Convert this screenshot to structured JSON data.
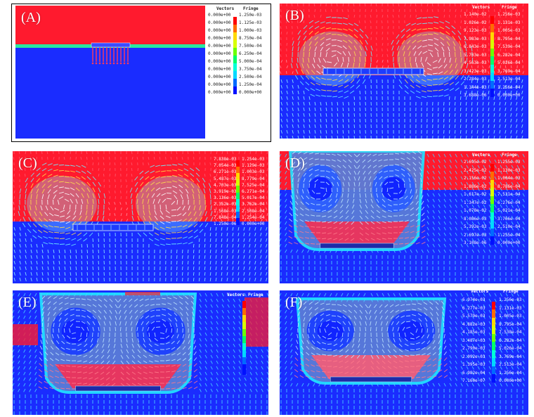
{
  "colors": {
    "red": "#ff1a2e",
    "blue": "#1a2cff",
    "cyan": "#22e0ff",
    "legend_scale": [
      "#ff0000",
      "#ff6a00",
      "#ffd800",
      "#d8ff00",
      "#6aff00",
      "#00ff6a",
      "#00ffd8",
      "#00d8ff",
      "#006aff",
      "#0010ff"
    ]
  },
  "panels": [
    {
      "label": "(A)",
      "legend": {
        "header_left": "Vectors",
        "header_right": "Fringe",
        "left": [
          "0.000e+00",
          "0.000e+00",
          "0.000e+00",
          "0.000e+00",
          "0.000e+00",
          "0.000e+00",
          "0.000e+00",
          "0.000e+00",
          "0.000e+00",
          "0.000e+00",
          "0.000e+00"
        ],
        "right": [
          "1.250e-03",
          "1.125e-03",
          "1.000e-03",
          "8.750e-04",
          "7.500e-04",
          "6.250e-04",
          "5.000e-04",
          "3.750e-04",
          "2.500e-04",
          "1.250e-04",
          "0.000e+00"
        ]
      }
    },
    {
      "label": "(B)",
      "legend": {
        "header_left": "Vectors",
        "header_right": "Fringe",
        "left": [
          "1.140e-02",
          "1.026e-02",
          "9.123e-03",
          "7.983e-03",
          "6.843e-03",
          "5.703e-03",
          "4.563e-03",
          "3.423e-03",
          "2.284e-03",
          "1.144e-03",
          "3.688e-06"
        ],
        "right": [
          "1.256e-03",
          "1.131e-03",
          "1.005e-03",
          "8.795e-04",
          "7.539e-04",
          "6.282e-04",
          "5.026e-04",
          "3.769e-04",
          "2.513e-04",
          "1.256e-04",
          "0.000e+00"
        ]
      }
    },
    {
      "label": "(C)",
      "legend": {
        "header_left": "",
        "header_right": "",
        "left": [
          "7.838e-03",
          "7.054e-03",
          "6.271e-03",
          "5.487e-03",
          "4.703e-03",
          "3.919e-03",
          "3.136e-03",
          "2.352e-03",
          "1.568e-03",
          "7.848e-04",
          "1.250e-06"
        ],
        "right": [
          "1.254e-03",
          "1.129e-03",
          "1.003e-03",
          "8.779e-04",
          "7.525e-04",
          "6.271e-04",
          "5.017e-04",
          "3.762e-04",
          "2.508e-04",
          "1.254e-04",
          "0.000e+00"
        ]
      }
    },
    {
      "label": "(D)",
      "legend": {
        "header_left": "Vectors",
        "header_right": "Fringe",
        "left": [
          "2.695e-02",
          "2.425e-02",
          "2.156e-02",
          "1.886e-02",
          "1.617e-02",
          "1.347e-02",
          "1.078e-02",
          "8.086e-03",
          "5.392e-03",
          "2.697e-03",
          "3.108e-06"
        ],
        "right": [
          "1.255e-03",
          "1.130e-03",
          "1.004e-03",
          "8.786e-04",
          "7.531e-04",
          "6.276e-04",
          "5.021e-04",
          "3.766e-04",
          "2.510e-04",
          "1.255e-04",
          "0.000e+00"
        ]
      }
    },
    {
      "label": "(E)",
      "legend": {
        "header_left": "Vectors",
        "header_right": "Fringe",
        "left": [],
        "right": []
      }
    },
    {
      "label": "(F)",
      "legend": {
        "header_left": "Vectors",
        "header_right": "Fringe",
        "left": [
          "6.974e-03",
          "6.277e-03",
          "5.579e-03",
          "4.882e-03",
          "4.185e-03",
          "3.487e-03",
          "2.790e-03",
          "2.092e-03",
          "1.395e-03",
          "6.982e-04",
          "7.160e-07"
        ],
        "right": [
          "1.256e-03",
          "1.131e-03",
          "1.005e-03",
          "8.795e-04",
          "7.538e-04",
          "6.282e-04",
          "5.026e-04",
          "3.769e-04",
          "2.513e-04",
          "1.256e-04",
          "0.000e+00"
        ]
      }
    }
  ]
}
